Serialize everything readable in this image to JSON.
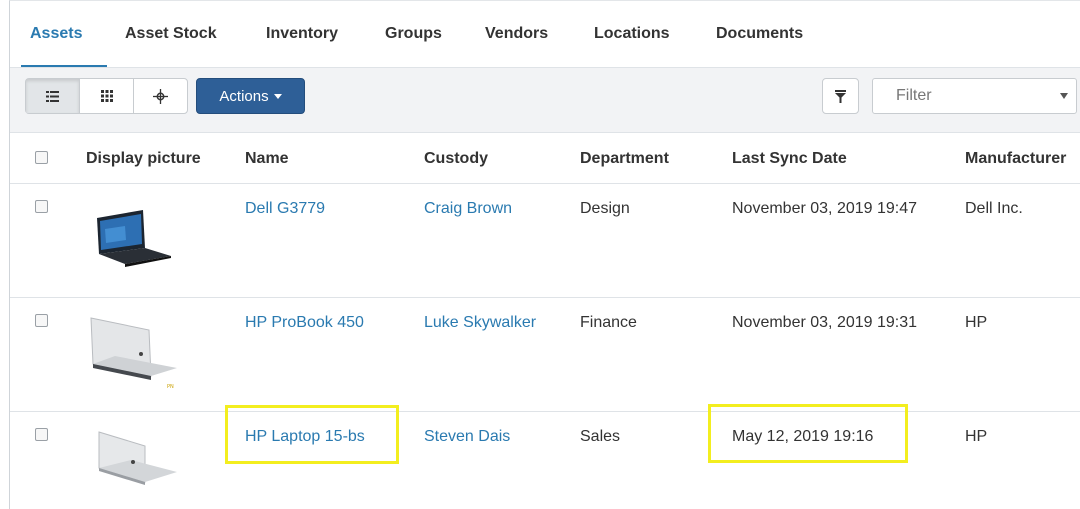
{
  "tabs": [
    {
      "label": "Assets",
      "active": true
    },
    {
      "label": "Asset Stock"
    },
    {
      "label": "Inventory"
    },
    {
      "label": "Groups"
    },
    {
      "label": "Vendors"
    },
    {
      "label": "Locations"
    },
    {
      "label": "Documents"
    }
  ],
  "toolbar": {
    "view_icons": [
      "list-view-icon",
      "grid-view-icon",
      "map-view-icon"
    ],
    "actions_label": "Actions",
    "filter_placeholder": "Filter"
  },
  "table": {
    "columns": [
      "Display picture",
      "Name",
      "Custody",
      "Department",
      "Last Sync Date",
      "Manufacturer"
    ],
    "rows": [
      {
        "name": "Dell G3779",
        "custody": "Craig Brown",
        "department": "Design",
        "last_sync": "November 03, 2019 19:47",
        "manufacturer": "Dell Inc.",
        "picture": "dell-laptop-image"
      },
      {
        "name": "HP ProBook 450",
        "custody": "Luke Skywalker",
        "department": "Finance",
        "last_sync": "November 03, 2019 19:31",
        "manufacturer": "HP",
        "picture": "hp-probook-image"
      },
      {
        "name": "HP Laptop 15-bs",
        "custody": "Steven Dais",
        "department": "Sales",
        "last_sync": "May 12, 2019 19:16",
        "manufacturer": "HP",
        "picture": "hp-laptop-image"
      }
    ]
  },
  "colors": {
    "accent": "#2a7ab0",
    "actions_bg": "#2e5f97",
    "highlight": "#f3ee1f"
  }
}
